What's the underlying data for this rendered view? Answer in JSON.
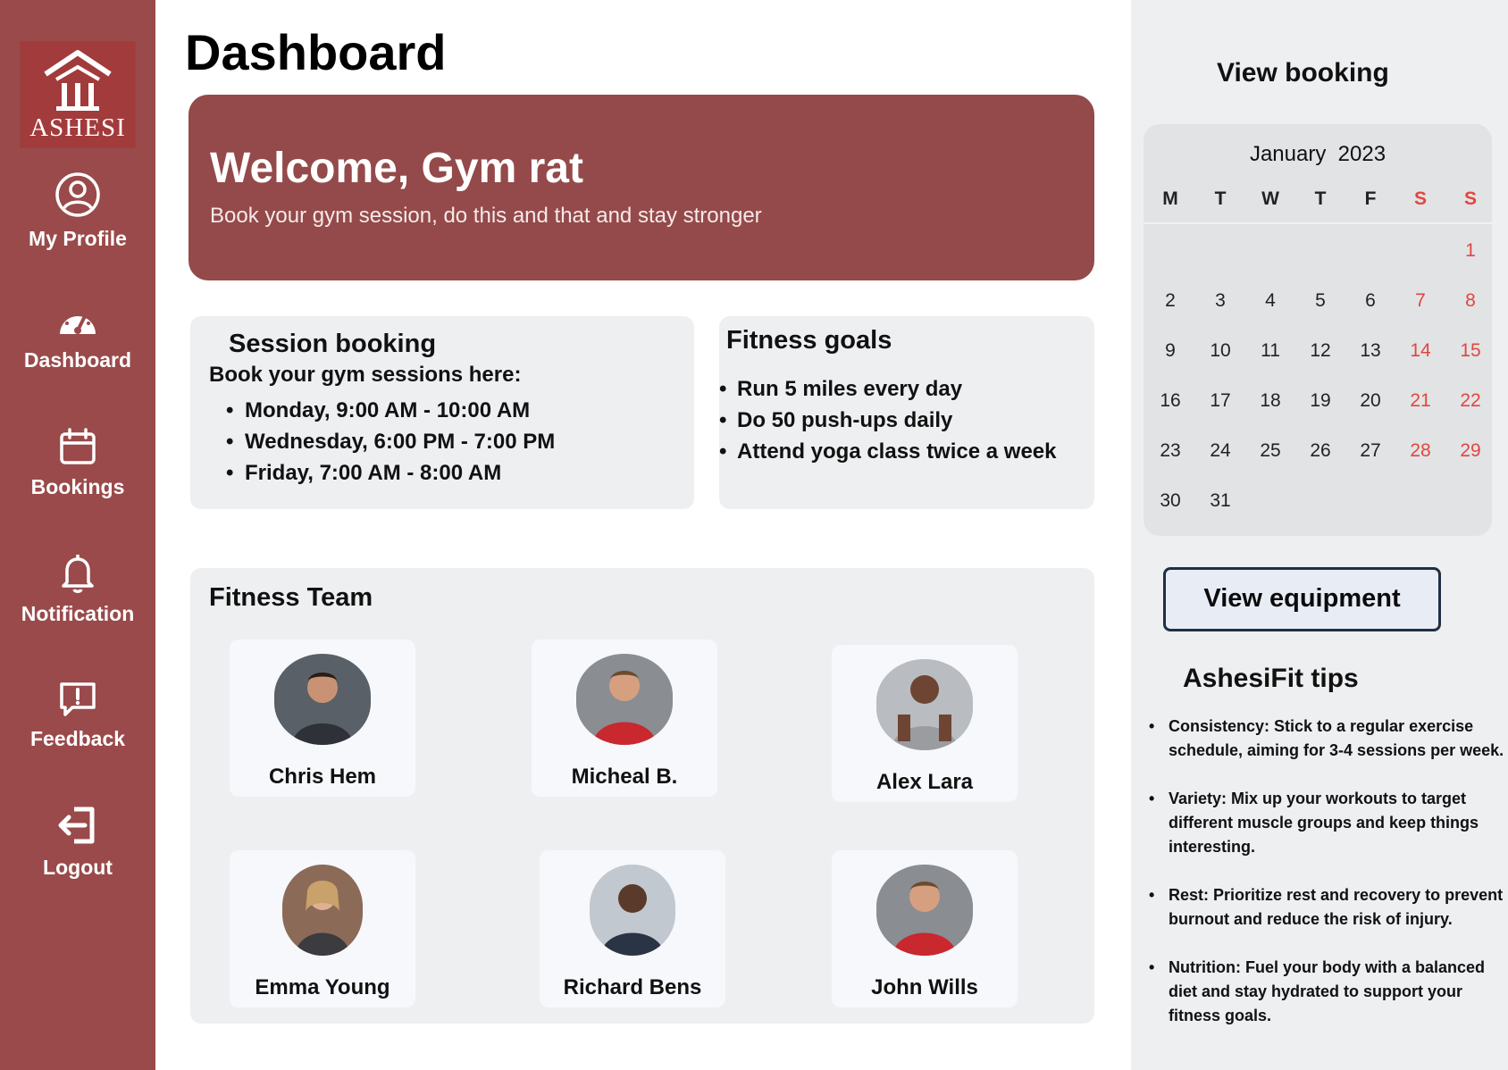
{
  "sidebar": {
    "logo_text": "ASHESI",
    "items": [
      {
        "label": "My Profile",
        "icon": "user-circle-icon"
      },
      {
        "label": "Dashboard",
        "icon": "gauge-icon"
      },
      {
        "label": "Bookings",
        "icon": "calendar-icon"
      },
      {
        "label": "Notification",
        "icon": "bell-icon"
      },
      {
        "label": "Feedback",
        "icon": "feedback-icon"
      },
      {
        "label": "Logout",
        "icon": "logout-icon"
      }
    ]
  },
  "main": {
    "title": "Dashboard",
    "welcome": {
      "title": "Welcome, Gym rat",
      "subtitle": "Book your gym session, do this and that and stay stronger"
    },
    "session": {
      "title": "Session booking",
      "intro": "Book your gym sessions here:",
      "slots": [
        "Monday, 9:00 AM - 10:00 AM",
        "Wednesday, 6:00 PM - 7:00 PM",
        "Friday, 7:00 AM - 8:00 AM"
      ]
    },
    "goals": {
      "title": "Fitness goals",
      "items": [
        "Run 5 miles every day",
        "Do 50 push-ups daily",
        "Attend yoga class twice a week"
      ]
    },
    "team": {
      "title": "Fitness Team",
      "members": [
        "Chris Hem",
        "Micheal B.",
        "Alex  Lara",
        "Emma Young",
        "Richard Bens",
        "John Wills"
      ]
    }
  },
  "right": {
    "view_booking_title": "View booking",
    "calendar": {
      "month": "January",
      "year": "2023",
      "days_of_week": [
        "M",
        "T",
        "W",
        "T",
        "F",
        "S",
        "S"
      ],
      "weekend_color": "#e0473f",
      "days": [
        "1",
        "2",
        "3",
        "4",
        "5",
        "6",
        "7",
        "8",
        "9",
        "10",
        "11",
        "12",
        "13",
        "14",
        "15",
        "16",
        "17",
        "18",
        "19",
        "20",
        "21",
        "22",
        "23",
        "24",
        "25",
        "26",
        "27",
        "28",
        "29",
        "30",
        "31"
      ]
    },
    "equipment_button": "View equipment",
    "tips_title": "AshesiFit tips",
    "tips": [
      "Consistency: Stick to a regular exercise schedule, aiming for 3-4 sessions per week.",
      "Variety: Mix up your workouts to target different muscle groups and keep things interesting.",
      "Rest: Prioritize rest and recovery to prevent burnout and reduce the risk of injury.",
      "Nutrition: Fuel your body with a balanced diet and stay hydrated to support your fitness goals."
    ]
  },
  "colors": {
    "sidebar": "#9a4a4a",
    "welcome_banner": "#944a4a",
    "card_background": "#eeeff1",
    "weekend": "#e0473f"
  }
}
